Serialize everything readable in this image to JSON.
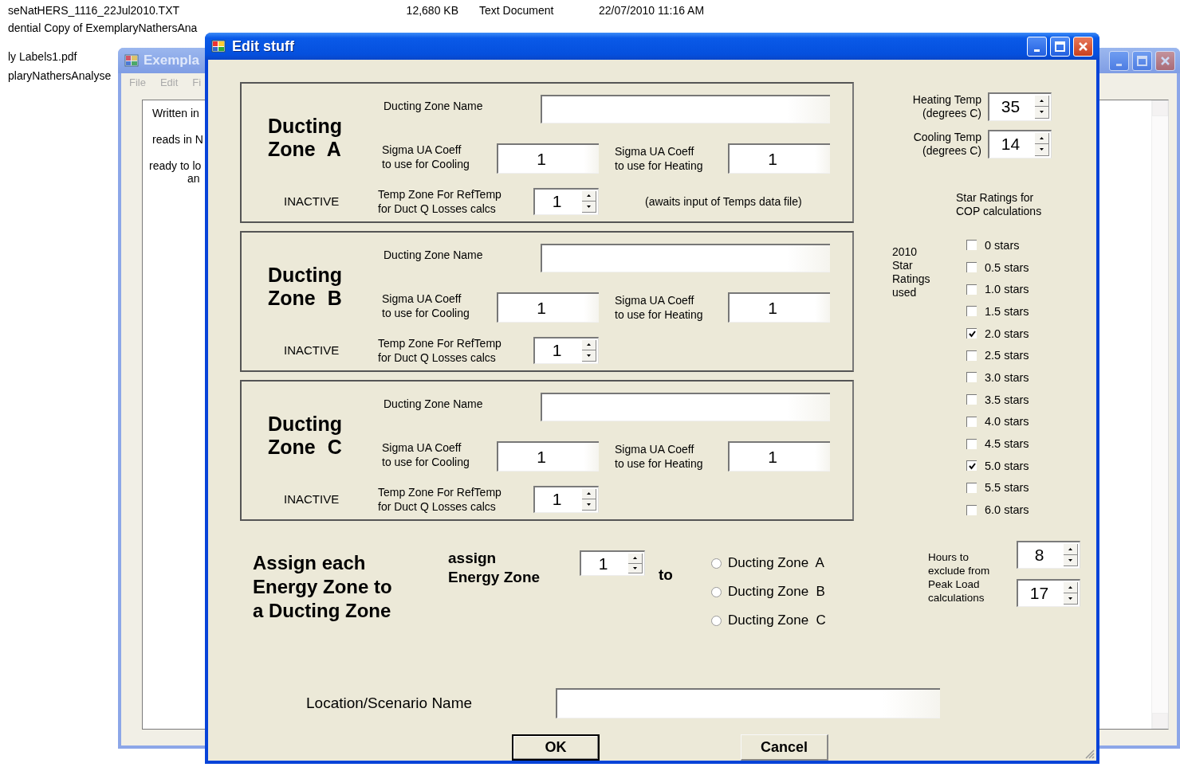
{
  "file_list": [
    {
      "name": "seNatHERS_1116_22Jul2010.TXT",
      "size": "12,680 KB",
      "type": "Text Document",
      "date": "22/07/2010 11:16 AM"
    },
    {
      "name": "dential Copy of ExemplaryNathersAna"
    },
    {
      "name": "ly Labels1.pdf"
    },
    {
      "name": "plaryNathersAnalyse"
    }
  ],
  "background_window": {
    "title": "Exempla",
    "menu": [
      "File",
      "Edit",
      "Fi"
    ],
    "log_lines": [
      "Written in",
      "reads in N",
      "ready to lo",
      "an"
    ]
  },
  "dialog": {
    "title": "Edit stuff",
    "zones": [
      {
        "title": "Ducting Zone A",
        "name_label": "Ducting Zone Name",
        "cooling_label": "Sigma UA Coeff\nto use for Cooling",
        "cooling_value": "1",
        "heating_label": "Sigma UA Coeff\nto use for Heating",
        "heating_value": "1",
        "status": "INACTIVE",
        "temp_zone_label": "Temp Zone For RefTemp\nfor Duct Q Losses calcs",
        "temp_zone_value": "1",
        "note": "(awaits input of Temps data file)"
      },
      {
        "title": "Ducting Zone B",
        "name_label": "Ducting Zone Name",
        "cooling_label": "Sigma UA Coeff\nto use for Cooling",
        "cooling_value": "1",
        "heating_label": "Sigma UA Coeff\nto use for Heating",
        "heating_value": "1",
        "status": "INACTIVE",
        "temp_zone_label": "Temp Zone For RefTemp\nfor Duct Q Losses calcs",
        "temp_zone_value": "1"
      },
      {
        "title": "Ducting Zone C",
        "name_label": "Ducting Zone Name",
        "cooling_label": "Sigma UA Coeff\nto use for Cooling",
        "cooling_value": "1",
        "heating_label": "Sigma UA Coeff\nto use for Heating",
        "heating_value": "1",
        "status": "INACTIVE",
        "temp_zone_label": "Temp Zone For RefTemp\nfor Duct Q Losses calcs",
        "temp_zone_value": "1"
      }
    ],
    "temperatures": [
      {
        "label": "Heating Temp\n(degrees C)",
        "value": "35"
      },
      {
        "label": "Cooling Temp\n(degrees C)",
        "value": "14"
      }
    ],
    "star_ratings": {
      "title": "Star Ratings for\nCOP calculations",
      "side_note": "2010\nStar\nRatings\nused",
      "options": [
        {
          "label": "0 stars",
          "checked": false
        },
        {
          "label": "0.5 stars",
          "checked": false
        },
        {
          "label": "1.0 stars",
          "checked": false
        },
        {
          "label": "1.5 stars",
          "checked": false
        },
        {
          "label": "2.0 stars",
          "checked": true
        },
        {
          "label": "2.5 stars",
          "checked": false
        },
        {
          "label": "3.0 stars",
          "checked": false
        },
        {
          "label": "3.5 stars",
          "checked": false
        },
        {
          "label": "4.0 stars",
          "checked": false
        },
        {
          "label": "4.5 stars",
          "checked": false
        },
        {
          "label": "5.0 stars",
          "checked": true
        },
        {
          "label": "5.5 stars",
          "checked": false
        },
        {
          "label": "6.0 stars",
          "checked": false
        }
      ]
    },
    "assign": {
      "heading": "Assign each\nEnergy Zone to\na Ducting Zone",
      "label": "assign\nEnergy Zone",
      "value": "1",
      "to": "to",
      "options": [
        {
          "label": "Ducting Zone  A",
          "selected": false
        },
        {
          "label": "Ducting Zone  B",
          "selected": false
        },
        {
          "label": "Ducting Zone  C",
          "selected": false
        }
      ]
    },
    "hours": {
      "label": "Hours to\nexclude from\nPeak Load\ncalculations",
      "values": [
        "8",
        "17"
      ]
    },
    "location": {
      "label": "Location/Scenario Name"
    },
    "buttons": [
      {
        "label": "OK",
        "default": true
      },
      {
        "label": "Cancel",
        "default": false
      }
    ]
  }
}
